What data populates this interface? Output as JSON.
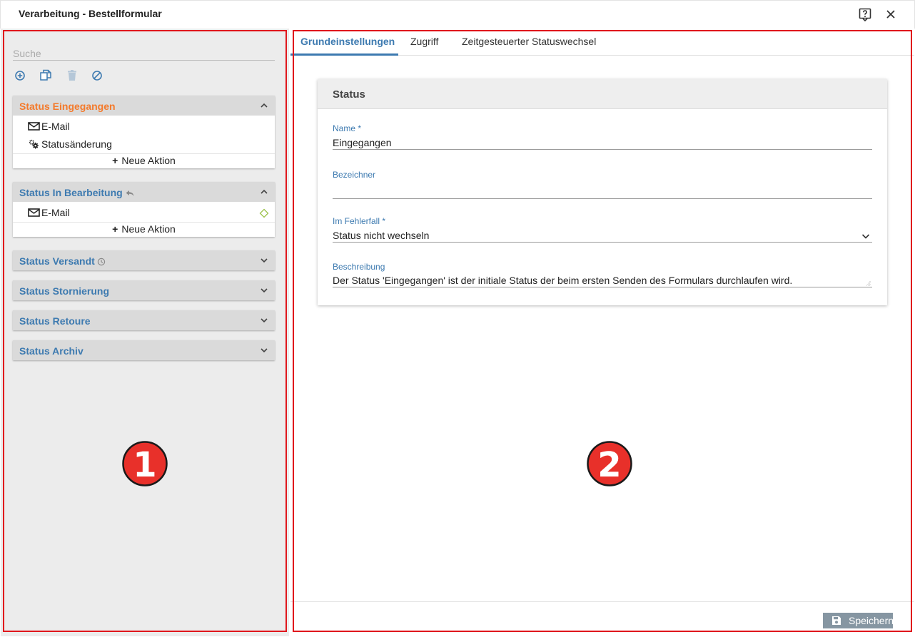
{
  "window": {
    "title": "Verarbeitung - Bestellformular",
    "help_icon": "help-icon",
    "close_icon": "close-icon"
  },
  "sidebar": {
    "search_placeholder": "Suche",
    "toolbar": [
      {
        "name": "add",
        "icon": "plus-circle-icon"
      },
      {
        "name": "copy",
        "icon": "copy-icon"
      },
      {
        "name": "delete",
        "icon": "trash-icon"
      },
      {
        "name": "disable",
        "icon": "block-icon"
      }
    ],
    "groups": [
      {
        "title": "Status Eingegangen",
        "expanded": true,
        "active": true,
        "actions": [
          {
            "label": "E-Mail",
            "icon": "mail-icon"
          },
          {
            "label": "Statusänderung",
            "icon": "gears-icon"
          }
        ],
        "new_action": "Neue Aktion"
      },
      {
        "title": "Status In Bearbeitung",
        "expanded": true,
        "extra_icon": "reply-icon",
        "actions": [
          {
            "label": "E-Mail",
            "icon": "mail-icon",
            "flag_icon": "diamond-icon"
          }
        ],
        "new_action": "Neue Aktion"
      },
      {
        "title": "Status Versandt",
        "expanded": false,
        "extra_icon": "clock-icon"
      },
      {
        "title": "Status Stornierung",
        "expanded": false
      },
      {
        "title": "Status Retoure",
        "expanded": false
      },
      {
        "title": "Status Archiv",
        "expanded": false
      }
    ]
  },
  "tabs": [
    {
      "label": "Grundeinstellungen",
      "active": true
    },
    {
      "label": "Zugriff"
    },
    {
      "label": "Zeitgesteuerter Statuswechsel"
    }
  ],
  "form": {
    "card_title": "Status",
    "name_label": "Name *",
    "name_value": "Eingegangen",
    "identifier_label": "Bezeichner",
    "identifier_value": "",
    "error_label": "Im Fehlerfall *",
    "error_value": "Status nicht wechseln",
    "description_label": "Beschreibung",
    "description_value": "Der Status 'Eingegangen' ist der initiale Status der beim ersten Senden des Formulars durchlaufen wird."
  },
  "footer": {
    "save_label": "Speichern",
    "save_icon": "floppy-icon"
  },
  "callouts": {
    "one": "1",
    "two": "2"
  },
  "colors": {
    "accent": "#3d7ab0",
    "active_status": "#f47a2b",
    "marker": "#e0161c",
    "save_button": "#8696a2"
  }
}
